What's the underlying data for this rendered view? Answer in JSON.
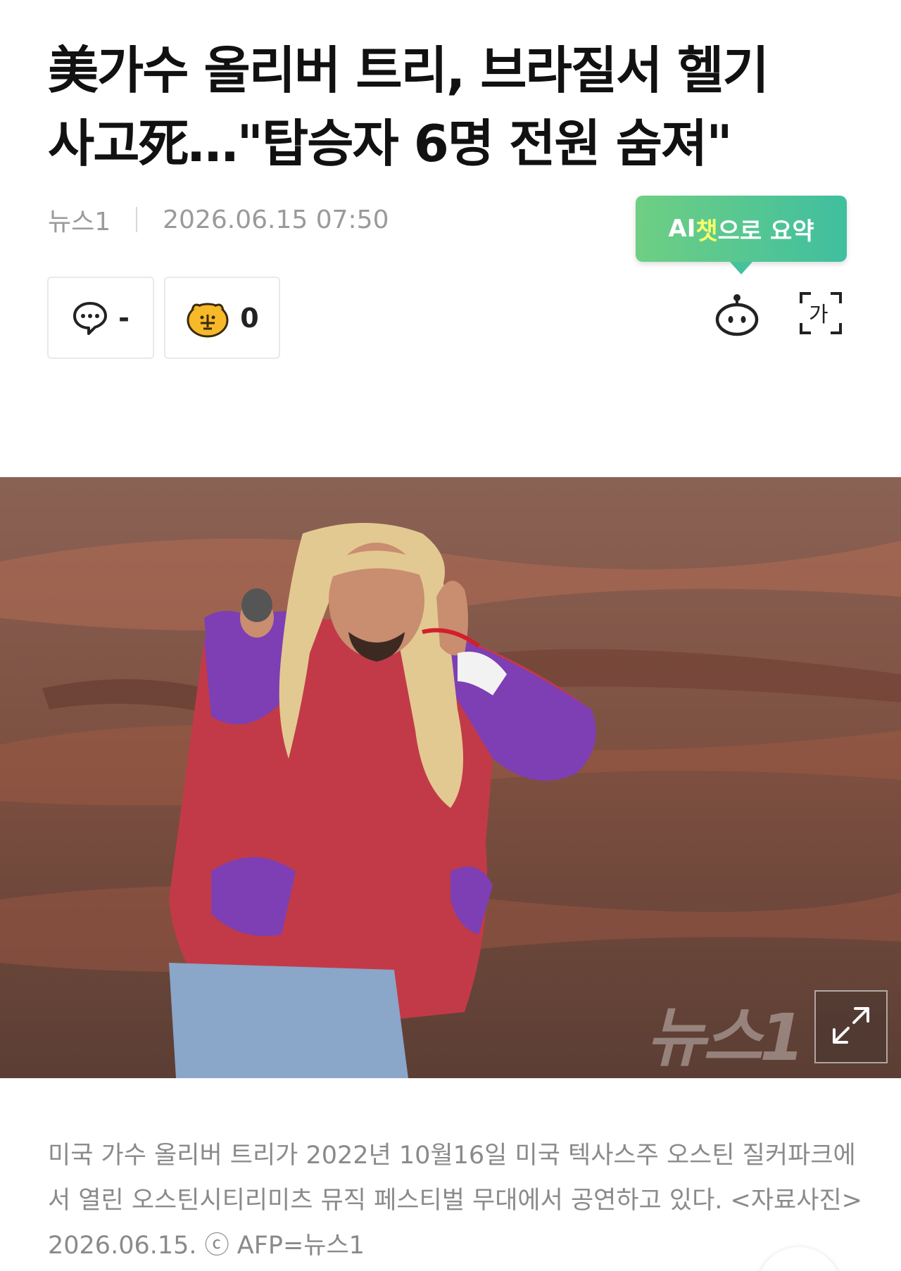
{
  "article": {
    "headline_line1": "美가수 올리버 트리, 브라질서 헬기",
    "headline_line2": "사고死…\"탑승자 6명 전원 숨져\"",
    "source": "뉴스1",
    "datetime": "2026.06.15 07:50"
  },
  "ai_summary": {
    "prefix": "AI",
    "highlight": "챗",
    "suffix": "으로 요약"
  },
  "reactions": {
    "comment_count": "-",
    "like_count": "0"
  },
  "icons": {
    "comment": "speech-bubble-icon",
    "like": "emoji-reaction-icon",
    "bot": "chatbot-icon",
    "font": "font-size-icon",
    "expand": "expand-icon"
  },
  "photo": {
    "watermark": "뉴스1"
  },
  "caption": {
    "line1": "미국 가수 올리버 트리가 2022년 10월16일 미국 텍사스주 오스틴 질커파크에",
    "line2": "서 열린 오스틴시티리미츠 뮤직 페스티벌 무대에서 공연하고 있다. <자료사진>",
    "line3": "2026.06.15. ⓒ AFP=뉴스1"
  },
  "colors": {
    "ai_gradient_start": "#6fcf83",
    "ai_gradient_end": "#3fbf9f",
    "ai_highlight": "#f6ff6a"
  }
}
